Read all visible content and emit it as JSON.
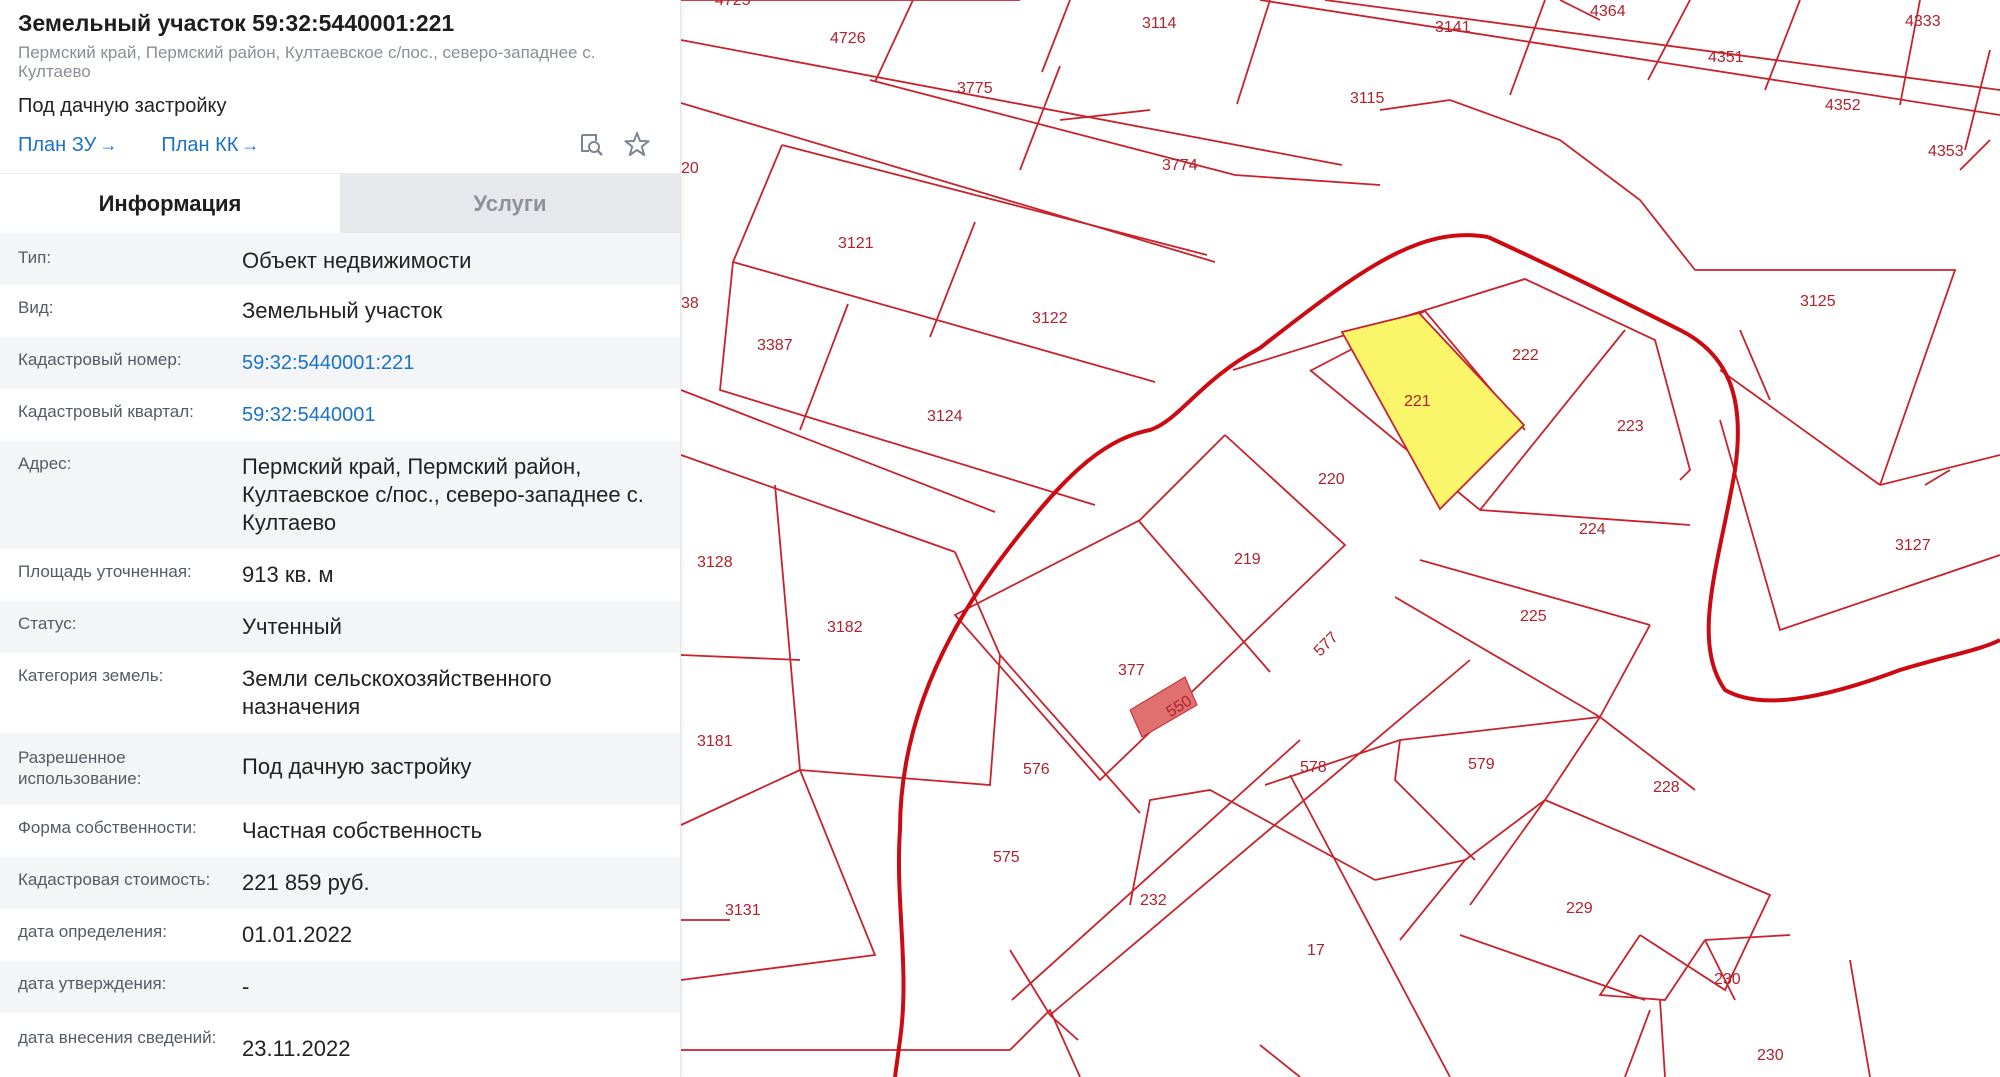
{
  "header": {
    "title": "Земельный участок 59:32:5440001:221",
    "address": "Пермский край, Пермский район, Култаевское с/пос., северо-западнее с. Култаево",
    "purpose": "Под дачную застройку",
    "link_plan_zu": "План ЗУ",
    "link_plan_kk": "План КК",
    "arrow": "→"
  },
  "tabs": {
    "info": "Информация",
    "services": "Услуги"
  },
  "info": {
    "type": {
      "label": "Тип:",
      "value": "Объект недвижимости"
    },
    "kind": {
      "label": "Вид:",
      "value": "Земельный участок"
    },
    "cadastral_number": {
      "label": "Кадастровый номер:",
      "value": "59:32:5440001:221"
    },
    "cadastral_quarter": {
      "label": "Кадастровый квартал:",
      "value": "59:32:5440001"
    },
    "address": {
      "label": "Адрес:",
      "value": "Пермский край, Пермский район, Култаевское с/пос., северо-западнее с. Култаево"
    },
    "area": {
      "label": "Площадь уточненная:",
      "value": "913 кв. м"
    },
    "status": {
      "label": "Статус:",
      "value": "Учтенный"
    },
    "land_category": {
      "label": "Категория земель:",
      "value": "Земли сельскохозяйственного назначения"
    },
    "permitted_use": {
      "label": "Разрешенное использование:",
      "value": "Под дачную застройку"
    },
    "ownership": {
      "label": "Форма собственности:",
      "value": "Частная собственность"
    },
    "cadastral_cost": {
      "label": "Кадастровая стоимость:",
      "value": "221 859 руб."
    },
    "date_determination": {
      "label": "дата определения:",
      "value": "01.01.2022"
    },
    "date_approval": {
      "label": "дата утверждения:",
      "value": "-"
    },
    "date_entry": {
      "label": "дата внесения сведений:",
      "value": "23.11.2022"
    }
  },
  "map": {
    "parcel_color": "#c8232c",
    "boundary_color": "#cc0a12",
    "selected_fill": "#fbf56a",
    "building_fill": "#e07070",
    "labels": [
      "4725",
      "4726",
      "3114",
      "3141",
      "4364",
      "4333",
      "4351",
      "3775",
      "3115",
      "4352",
      "4353",
      "3774",
      "20",
      "3121",
      "3125",
      "3122",
      "38",
      "3387",
      "222",
      "221",
      "223",
      "3124",
      "220",
      "224",
      "3127",
      "3128",
      "219",
      "3182",
      "377",
      "550",
      "225",
      "577",
      "578",
      "579",
      "3181",
      "576",
      "228",
      "575",
      "229",
      "232",
      "3131",
      "17",
      "230",
      "230"
    ]
  },
  "colors": {
    "link": "#1a73c8",
    "tab_inactive_bg": "#e6e8ec"
  }
}
